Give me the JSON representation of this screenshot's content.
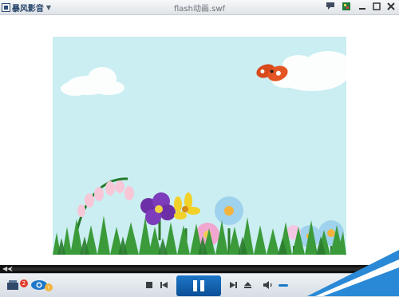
{
  "app": {
    "name": "暴风影音",
    "window_title": "flash动画.swf"
  },
  "titlebar_buttons": [
    {
      "name": "feedback-icon"
    },
    {
      "name": "skin-icon"
    },
    {
      "name": "minimize-icon"
    },
    {
      "name": "maximize-icon"
    },
    {
      "name": "close-icon"
    }
  ],
  "playback": {
    "state": "paused",
    "progress_fraction": 0.0,
    "playlist_badge": "2"
  },
  "colors": {
    "accent": "#1e77c8",
    "sky": "#cbeef2",
    "grass": "#3b9b3a",
    "progress_bg": "#121212"
  }
}
